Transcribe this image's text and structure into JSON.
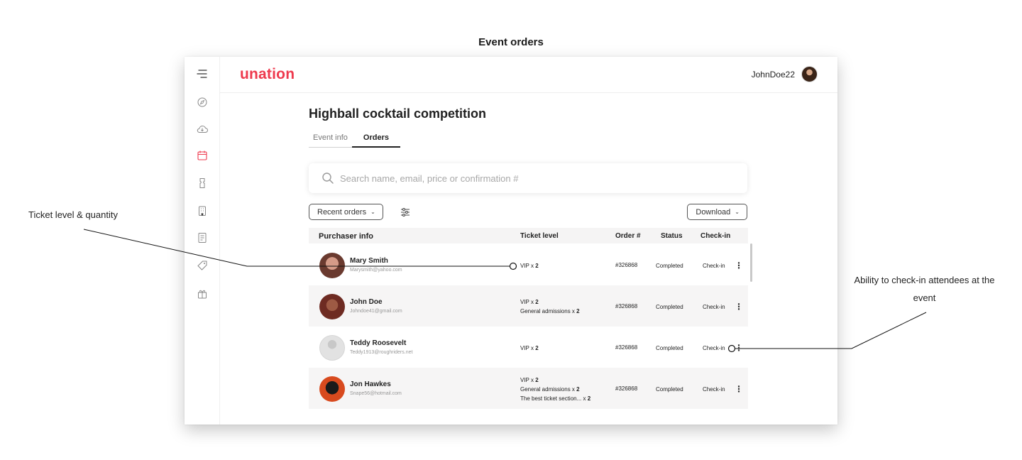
{
  "page": {
    "heading": "Event orders"
  },
  "annotations": {
    "left": "Ticket level & quantity",
    "right": "Ability to check-in attendees at the event"
  },
  "app": {
    "logo": "unation",
    "user": "JohnDoe22",
    "brand_color": "#ee3a4e",
    "sidebar_icons": [
      "menu-icon",
      "compass-icon",
      "cloud-download-icon",
      "calendar-icon",
      "ticket-icon",
      "building-icon",
      "receipt-icon",
      "tag-icon",
      "gift-icon"
    ]
  },
  "event": {
    "title": "Highball cocktail competition",
    "tabs": [
      {
        "label": "Event info",
        "active": false
      },
      {
        "label": "Orders",
        "active": true
      }
    ]
  },
  "search": {
    "placeholder": "Search name, email, price or confirmation #"
  },
  "controls": {
    "sort_label": "Recent orders",
    "download_label": "Download"
  },
  "table": {
    "headers": [
      "Purchaser info",
      "Ticket level",
      "Order #",
      "Status",
      "Check-in"
    ],
    "rows": [
      {
        "name": "Mary Smith",
        "email": "Marysmith@yahoo.com",
        "tickets": [
          {
            "level": "VIP x",
            "qty": "2"
          }
        ],
        "order": "#326868",
        "status": "Completed",
        "checkin": "Check-in"
      },
      {
        "name": "John Doe",
        "email": "Johndoe41@gmail.com",
        "tickets": [
          {
            "level": "VIP x",
            "qty": "2"
          },
          {
            "level": "General admissions x",
            "qty": "2"
          }
        ],
        "order": "#326868",
        "status": "Completed",
        "checkin": "Check-in"
      },
      {
        "name": "Teddy Roosevelt",
        "email": "Teddy1913@roughriders.net",
        "tickets": [
          {
            "level": "VIP x",
            "qty": "2"
          }
        ],
        "order": "#326868",
        "status": "Completed",
        "checkin": "Check-in"
      },
      {
        "name": "Jon Hawkes",
        "email": "Snape56@hotmail.com",
        "tickets": [
          {
            "level": "VIP x",
            "qty": "2"
          },
          {
            "level": "General admissions x",
            "qty": "2"
          },
          {
            "level": "The best ticket section... x",
            "qty": "2"
          }
        ],
        "order": "#326868",
        "status": "Completed",
        "checkin": "Check-in"
      }
    ]
  }
}
